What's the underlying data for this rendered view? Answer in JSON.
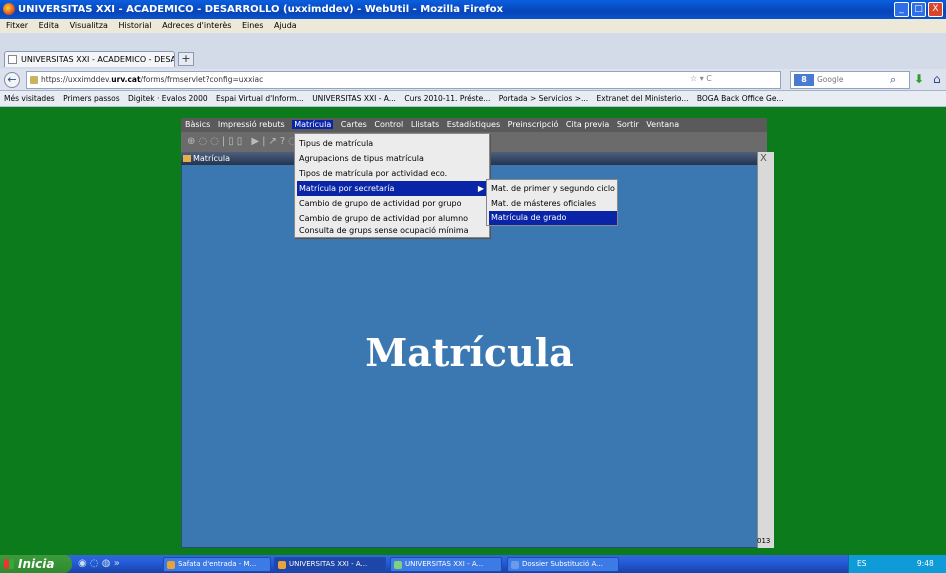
{
  "window": {
    "title": "UNIVERSITAS XXI - ACADEMICO - DESARROLLO (uxximddev) - WebUtil - Mozilla Firefox",
    "min_label": "_",
    "max_label": "□",
    "close_label": "X"
  },
  "menubar": [
    "Fitxer",
    "Edita",
    "Visualitza",
    "Historial",
    "Adreces d'interès",
    "Eines",
    "Ajuda"
  ],
  "tab": {
    "label": "UNIVERSITAS XXI - ACADEMICO - DESARRO...",
    "new_tab": "+"
  },
  "nav": {
    "back": "←",
    "url_prefix": "https://uxximddev.",
    "url_host": "urv.cat",
    "url_path": "/forms/frmservlet?config=uxxiac",
    "url_right": "☆ ▾ C",
    "search_engine": "8",
    "search_placeholder": "Google",
    "search_icon": "⌕",
    "download_icon": "⬇",
    "home_icon": "⌂"
  },
  "bookmarks": [
    "Més visitades",
    "Primers passos",
    "Digitek · Evalos 2000",
    "Espai Virtual d'Inform...",
    "UNIVERSITAS XXI - A...",
    "Curs 2010-11. Préste...",
    "Portada > Servicios >...",
    "Extranet del Ministerio...",
    "BOGA  Back Office Ge..."
  ],
  "app": {
    "menu": [
      "Bàsics",
      "Impressió rebuts",
      "Matrícula",
      "Cartes",
      "Control",
      "Llistats",
      "Estadístiques",
      "Preinscripció",
      "Cita previa",
      "Sortir",
      "Ventana"
    ],
    "selected_menu": "Matrícula",
    "toolbar_glyphs": "⊕◌◌|▯▯ ▶|↗?◌▯▯|▯▯|▯",
    "inner_title": "Matrícula",
    "big_title": "Matrícula",
    "close_label": "X",
    "corner_number": "013"
  },
  "dropdown": {
    "items": [
      {
        "label": "Tipus de matrícula",
        "selected": false
      },
      {
        "label": "Agrupacions de tipus matrícula",
        "selected": false
      },
      {
        "label": "Tipos de matrícula por actividad eco.",
        "selected": false
      },
      {
        "label": "Matrícula por secretaría",
        "selected": true,
        "arrow": "▶"
      },
      {
        "label": "Cambio de grupo de actividad por grupo",
        "selected": false
      },
      {
        "label": "Cambio de grupo de actividad por alumno",
        "selected": false
      },
      {
        "label": "Consulta de grups sense ocupació mínima",
        "selected": false
      }
    ],
    "submenu": [
      {
        "label": "Mat. de primer y segundo ciclo",
        "selected": false
      },
      {
        "label": "Mat. de másteres oficiales",
        "selected": false
      },
      {
        "label": "Matrícula de grado",
        "selected": true
      }
    ]
  },
  "taskbar": {
    "start": "Inicia",
    "quick": "◉ ◌ ◍ »",
    "tasks": [
      {
        "label": "Safata d'entrada - M...",
        "active": false
      },
      {
        "label": "UNIVERSITAS XXI - A...",
        "active": true
      },
      {
        "label": "UNIVERSITAS XXI - A...",
        "active": false
      },
      {
        "label": "Dossier Substitució A...",
        "active": false
      }
    ],
    "tray_lang": "ES",
    "clock": "9:48"
  },
  "colors": {
    "desktop": "#0b7b1b",
    "selection": "#0a24a8",
    "inner_bg": "#3b78b1"
  }
}
